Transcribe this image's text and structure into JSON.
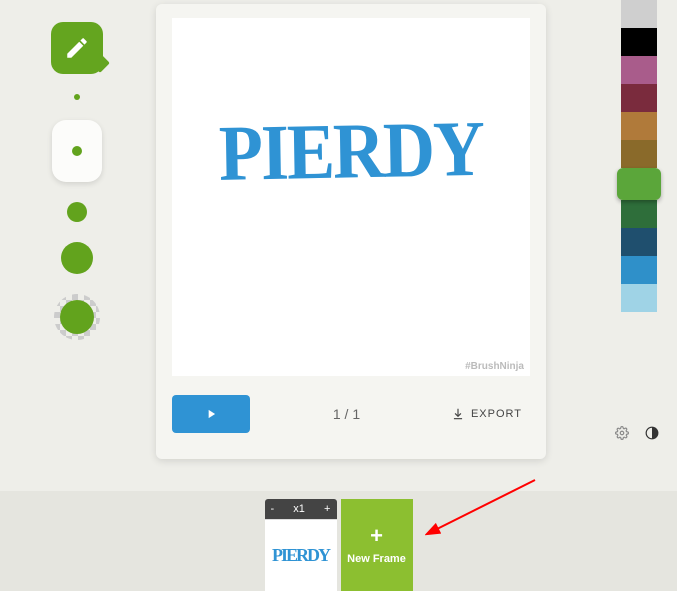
{
  "canvas": {
    "drawn_text": "PIERDY",
    "watermark": "#BrushNinja"
  },
  "controls": {
    "frame_counter": "1 / 1",
    "export_label": "EXPORT"
  },
  "palette": {
    "colors": [
      "#cfcfcf",
      "#000000",
      "#a95c8b",
      "#7a2b3d",
      "#b07a3a",
      "#8a6a2a",
      "#5ba63a",
      "#2e6e3a",
      "#1f4f6e",
      "#2f90c9",
      "#9fd3e6"
    ],
    "selected_index": 6,
    "selected_color": "#5ba63a"
  },
  "timeline": {
    "speed": {
      "minus": "-",
      "value": "x1",
      "plus": "+"
    },
    "frames": [
      {
        "thumb_text": "PIERDY"
      }
    ],
    "new_frame_label": "New Frame",
    "new_frame_plus": "+"
  }
}
